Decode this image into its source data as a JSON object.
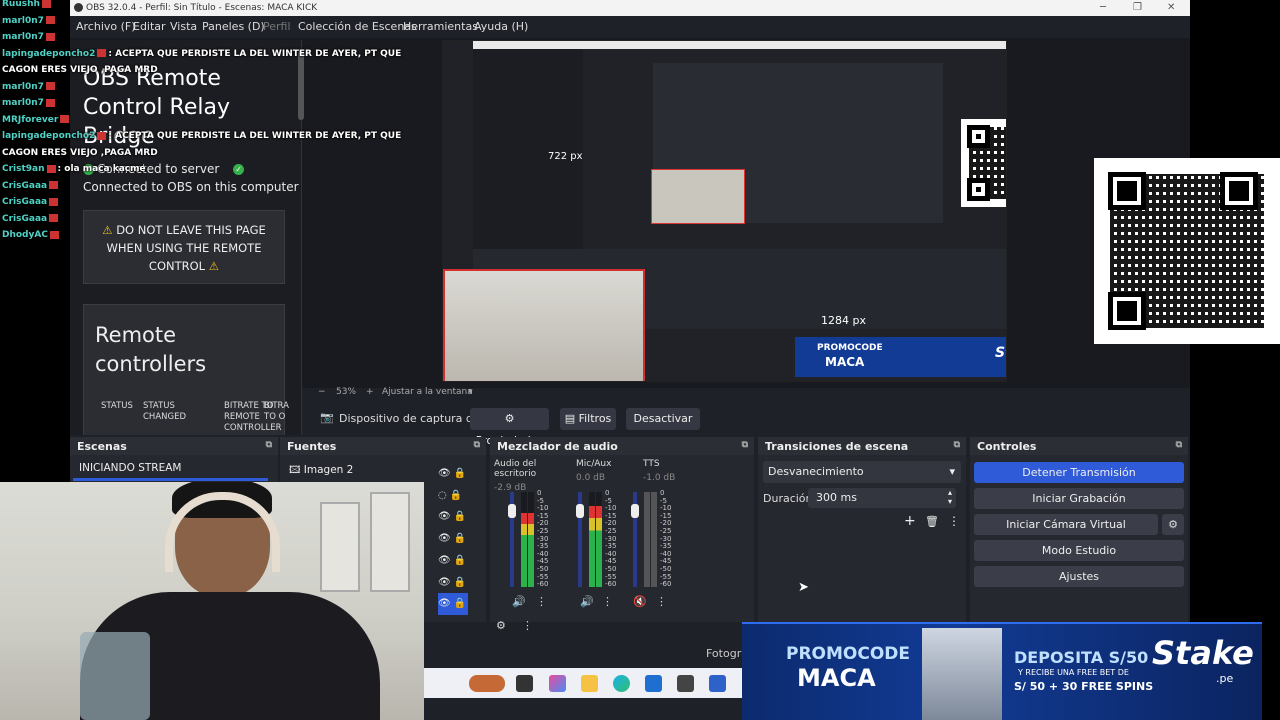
{
  "window": {
    "title": "OBS 32.0.4 - Perfil: Sin Título - Escenas: MACA KICK"
  },
  "menu": [
    "Archivo (F)",
    "Editar",
    "Vista",
    "Paneles (D)",
    "Perfil",
    "Colección de Escenas",
    "Herramientas",
    "Ayuda (H)"
  ],
  "relay": {
    "title": "OBS Remote Control Relay Bridge",
    "connected_server": "Connected to server",
    "connected_obs": "Connected to OBS on this computer",
    "warning": "DO NOT LEAVE THIS PAGE WHEN USING THE REMOTE CONTROL",
    "remote_title": "Remote controllers",
    "cols": [
      "STATUS",
      "STATUS CHANGED",
      "BITRATE TO REMOTE CONTROLLER",
      "BITRA TO O"
    ]
  },
  "nested": {
    "px_label_1": "722 px",
    "px_label_2": "1284 px",
    "promocode": "PROMOCODE",
    "maca": "MACA",
    "stake": "Stake"
  },
  "zoombar": {
    "zoom": "53%",
    "fit": "Ajustar a la ventana"
  },
  "sourcebar": {
    "source": "Dispositivo de captura de v",
    "properties": "Propiedades",
    "filters": "Filtros",
    "deactivate": "Desactivar"
  },
  "scenes": {
    "title": "Escenas",
    "items": [
      "INICIANDO STREAM"
    ]
  },
  "sources": {
    "title": "Fuentes",
    "items": [
      "Imagen 2"
    ]
  },
  "mixer": {
    "title": "Mezclador de audio",
    "channels": [
      {
        "name": "Audio del escritorio",
        "db": "-2.9 dB",
        "level": 0.78
      },
      {
        "name": "Mic/Aux",
        "db": "0.0 dB",
        "level": 0.85
      },
      {
        "name": "TTS",
        "db": "-1.0 dB",
        "level": 0.0
      }
    ],
    "scale": [
      "0",
      "-5",
      "-10",
      "-15",
      "-20",
      "-25",
      "-30",
      "-35",
      "-40",
      "-45",
      "-50",
      "-55",
      "-60"
    ]
  },
  "transitions": {
    "title": "Transiciones de escena",
    "type": "Desvanecimiento",
    "duration_label": "Duración",
    "duration": "300 ms"
  },
  "controls": {
    "title": "Controles",
    "buttons": [
      "Detener Transmisión",
      "Iniciar Grabación",
      "Iniciar Cámara Virtual",
      "Modo Estudio",
      "Ajustes"
    ]
  },
  "chat": [
    {
      "user": "Ruushh",
      "msg": ""
    },
    {
      "user": "marl0n7",
      "msg": ""
    },
    {
      "user": "marl0n7",
      "msg": ""
    },
    {
      "user": "lapingadeponcho2",
      "msg": ": ACEPTA QUE PERDISTE LA DEL WINTER DE AYER, PT QUE"
    },
    {
      "user": "",
      "msg": "CAGON ERES VIEJO ,PAGA MRD"
    },
    {
      "user": "marl0n7",
      "msg": ""
    },
    {
      "user": "marl0n7",
      "msg": ""
    },
    {
      "user": "MRJforever",
      "msg": ""
    },
    {
      "user": "lapingadeponcho2",
      "msg": ": ACEPTA QUE PERDISTE LA DEL WINTER DE AYER, PT QUE"
    },
    {
      "user": "",
      "msg": "CAGON ERES VIEJO ,PAGA MRD"
    },
    {
      "user": "Crist9an",
      "msg": ": ola maca kacme"
    },
    {
      "user": "CrisGaaa",
      "msg": ""
    },
    {
      "user": "CrisGaaa",
      "msg": ""
    },
    {
      "user": "CrisGaaa",
      "msg": ""
    },
    {
      "user": "DhodyAC",
      "msg": ""
    }
  ],
  "promo": {
    "code_label": "PROMOCODE",
    "code": "MACA",
    "deposit": "DEPOSITA S/50",
    "bonus": "Y RECIBE UNA FREE BET DE",
    "amount": "S/ 50 + 30 FREE SPINS",
    "brand": "Stake",
    "brand_sub": ".pe"
  },
  "taskbar": {
    "label": "Fotograf"
  },
  "colors": {
    "accent": "#2f5bd8",
    "obs_bg": "#1f2128",
    "dock_bg": "#26282f",
    "promo_blue": "#123b95"
  }
}
